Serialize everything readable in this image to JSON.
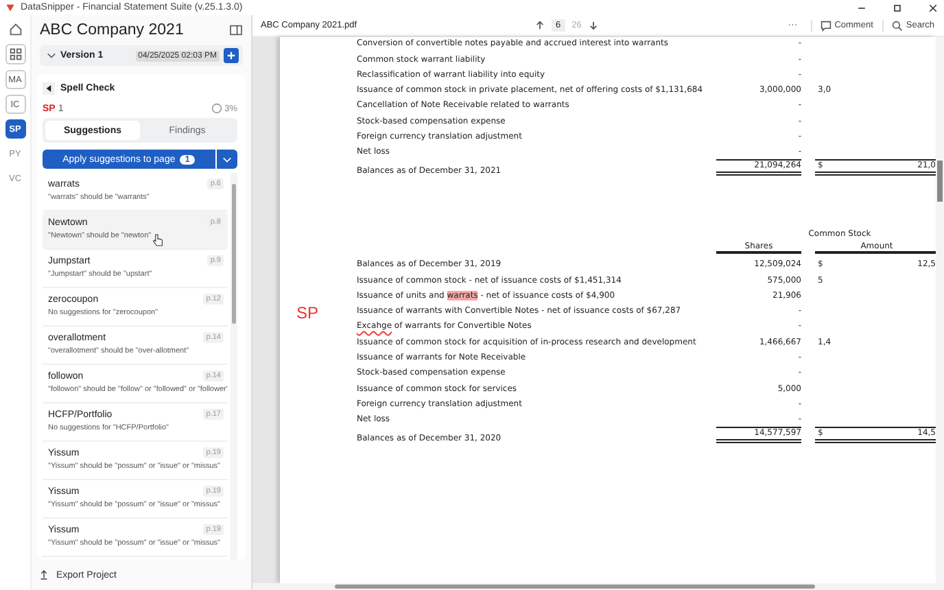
{
  "window": {
    "title": "DataSnipper - Financial Statement Suite (v.25.1.3.0)"
  },
  "rail": [
    {
      "kind": "home",
      "selected": false
    },
    {
      "kind": "grid",
      "selected": false
    },
    {
      "kind": "text",
      "label": "MA",
      "selected": false,
      "disabled": false
    },
    {
      "kind": "text",
      "label": "IC",
      "selected": false,
      "disabled": false
    },
    {
      "kind": "text",
      "label": "SP",
      "selected": true,
      "disabled": false
    },
    {
      "kind": "text",
      "label": "PY",
      "selected": false,
      "disabled": true
    },
    {
      "kind": "text",
      "label": "VC",
      "selected": false,
      "disabled": true
    }
  ],
  "sidebar": {
    "title": "ABC Company 2021",
    "version": "Version 1",
    "version_date": "04/25/2025 02:03 PM",
    "panel_title": "Spell Check",
    "code": "SP",
    "count": "1",
    "progress": "3%",
    "tabs": [
      {
        "label": "Suggestions",
        "selected": true
      },
      {
        "label": "Findings",
        "selected": false
      }
    ],
    "apply_button": "Apply suggestions to page",
    "apply_count": "1",
    "items": [
      {
        "word": "warrats",
        "hint": "\"warrats\" should be \"warrants\"",
        "page": "p.6",
        "hovered": false
      },
      {
        "word": "Newtown",
        "hint": "\"Newtown\" should be \"newton\"",
        "page": "p.8",
        "hovered": true
      },
      {
        "word": "Jumpstart",
        "hint": "\"Jumpstart\" should be \"upstart\"",
        "page": "p.9",
        "hovered": false
      },
      {
        "word": "zerocoupon",
        "hint": "No suggestions for \"zerocoupon\"",
        "page": "p.12",
        "hovered": false
      },
      {
        "word": "overallotment",
        "hint": "\"overallotment\" should be \"over-allotment\"",
        "page": "p.14",
        "hovered": false
      },
      {
        "word": "followon",
        "hint": "\"followon\" should be \"follow\" or \"followed\" or \"follower\"",
        "page": "p.14",
        "hovered": false
      },
      {
        "word": "HCFP/Portfolio",
        "hint": "No suggestions for \"HCFP/Portfolio\"",
        "page": "p.17",
        "hovered": false
      },
      {
        "word": "Yissum",
        "hint": "\"Yissum\" should be \"possum\" or \"issue\" or \"missus\"",
        "page": "p.19",
        "hovered": false
      },
      {
        "word": "Yissum",
        "hint": "\"Yissum\" should be \"possum\" or \"issue\" or \"missus\"",
        "page": "p.19",
        "hovered": false
      },
      {
        "word": "Yissum",
        "hint": "\"Yissum\" should be \"possum\" or \"issue\" or \"missus\"",
        "page": "p.19",
        "hovered": false
      }
    ],
    "footer": "Export Project"
  },
  "document": {
    "file": "ABC Company 2021.pdf",
    "page": "6",
    "pages": "26",
    "more": "···",
    "actions": [
      {
        "kind": "comment",
        "label": "Comment"
      },
      {
        "kind": "search",
        "label": "Search"
      }
    ],
    "margin_mark": "SP",
    "top_rows": [
      {
        "label": "Conversion of convertible notes payable and accrued interest into warrants",
        "shares": "-",
        "dollar": "",
        "amount": "",
        "total": false
      },
      {
        "label": "Common stock warrant liability",
        "shares": "-",
        "dollar": "",
        "amount": "",
        "total": false
      },
      {
        "label": "Reclassification of warrant liability into equity",
        "shares": "-",
        "dollar": "",
        "amount": "",
        "total": false
      },
      {
        "label": "Issuance of common stock in private placement, net of offering costs of $1,131,684",
        "shares": "3,000,000",
        "dollar": "",
        "amount": "3,0",
        "total": false
      },
      {
        "label": "Cancellation of Note Receivable related to warrants",
        "shares": "-",
        "dollar": "",
        "amount": "",
        "total": false
      },
      {
        "label": "Stock-based compensation expense",
        "shares": "-",
        "dollar": "",
        "amount": "",
        "total": false
      },
      {
        "label": "Foreign currency translation adjustment",
        "shares": "-",
        "dollar": "",
        "amount": "",
        "total": false
      },
      {
        "label": "Net loss",
        "shares": "-",
        "dollar": "",
        "amount": "",
        "total": false
      },
      {
        "label": "Balances as of December 31, 2021",
        "shares": "21,094,264",
        "dollar": "$",
        "amount": "21,0",
        "total": true
      }
    ],
    "group_header": "Common Stock",
    "columns": [
      "Shares",
      "Amount"
    ],
    "bottom_rows": [
      {
        "label": "Balances as of December 31, 2019",
        "shares": "12,509,024",
        "dollar": "$",
        "amount": "12,5",
        "total": false
      },
      {
        "label": "Issuance of common stock - net of issuance costs of $1,451,314",
        "shares": "575,000",
        "dollar": "",
        "amount": "5",
        "total": false
      },
      {
        "parts": [
          {
            "text": "Issuance of units and ",
            "kind": "plain"
          },
          {
            "text": "warrats",
            "kind": "highlight"
          },
          {
            "text": " - net of issuance costs of $4,900",
            "kind": "plain"
          }
        ],
        "shares": "21,906",
        "dollar": "",
        "amount": "",
        "total": false
      },
      {
        "label": "Issuance of warrants with Convertible Notes - net of issuance costs of $67,287",
        "shares": "-",
        "dollar": "",
        "amount": "",
        "total": false
      },
      {
        "parts": [
          {
            "text": "Excahge",
            "kind": "squiggle"
          },
          {
            "text": " of warrants for Convertible Notes",
            "kind": "plain"
          }
        ],
        "shares": "-",
        "dollar": "",
        "amount": "",
        "total": false
      },
      {
        "label": "Issuance of common stock for acquisition of in-process research and development",
        "shares": "1,466,667",
        "dollar": "",
        "amount": "1,4",
        "total": false
      },
      {
        "label": "Issuance of warrants for Note Receivable",
        "shares": "-",
        "dollar": "",
        "amount": "",
        "total": false
      },
      {
        "label": "Stock-based compensation expense",
        "shares": "-",
        "dollar": "",
        "amount": "",
        "total": false
      },
      {
        "label": "Issuance of common stock for services",
        "shares": "5,000",
        "dollar": "",
        "amount": "",
        "total": false
      },
      {
        "label": "Foreign currency translation adjustment",
        "shares": "-",
        "dollar": "",
        "amount": "",
        "total": false
      },
      {
        "label": "Net loss",
        "shares": "-",
        "dollar": "",
        "amount": "",
        "total": false
      },
      {
        "label": "Balances as of December 31, 2020",
        "shares": "14,577,597",
        "dollar": "$",
        "amount": "14,5",
        "total": true
      }
    ]
  }
}
